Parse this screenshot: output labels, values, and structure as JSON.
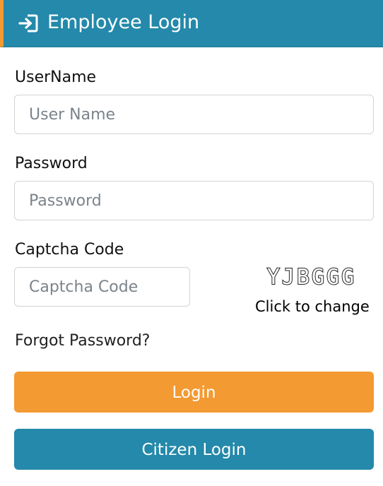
{
  "header": {
    "icon": "sign-in-icon",
    "title": "Employee Login",
    "accent_color": "#f39a32",
    "background_color": "#2489aa"
  },
  "form": {
    "username": {
      "label": "UserName",
      "value": "",
      "placeholder": "User Name"
    },
    "password": {
      "label": "Password",
      "value": "",
      "placeholder": "Password"
    },
    "captcha": {
      "label": "Captcha Code",
      "value": "",
      "placeholder": "Captcha Code",
      "image_text": "YJBGGG",
      "change_text": "Click to change"
    },
    "forgot_password": "Forgot Password?"
  },
  "buttons": {
    "login": {
      "label": "Login",
      "color": "#f39a32"
    },
    "citizen_login": {
      "label": "Citizen Login",
      "color": "#2489aa"
    }
  }
}
